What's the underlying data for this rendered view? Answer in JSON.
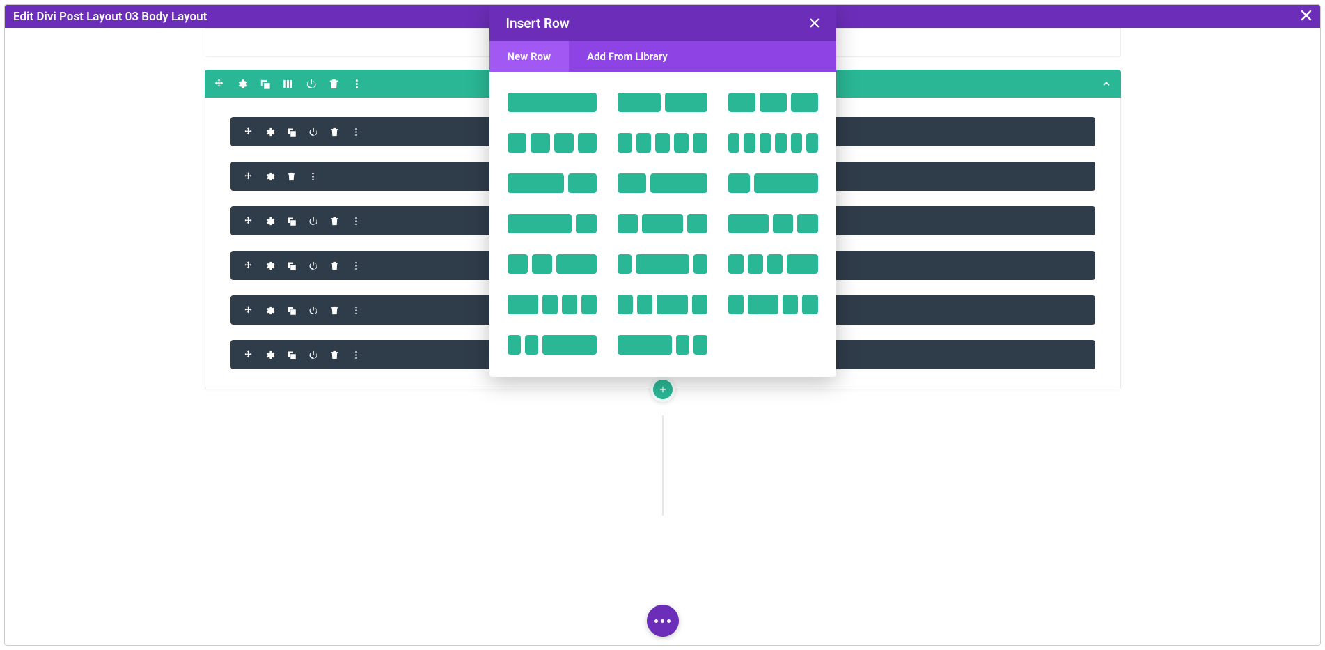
{
  "title_bar": {
    "title": "Edit Divi Post Layout 03 Body Layout"
  },
  "modal": {
    "title": "Insert Row",
    "tabs": [
      {
        "label": "New Row",
        "active": true
      },
      {
        "label": "Add From Library",
        "active": false
      }
    ],
    "layouts": [
      [
        1
      ],
      [
        1,
        1
      ],
      [
        1,
        1,
        1
      ],
      [
        1,
        1,
        1,
        1
      ],
      [
        1,
        1,
        1,
        1,
        1
      ],
      [
        1,
        1,
        1,
        1,
        1,
        1
      ],
      [
        2,
        1
      ],
      [
        1,
        2
      ],
      [
        1,
        3
      ],
      [
        3,
        1
      ],
      [
        1,
        2,
        1
      ],
      [
        2,
        1,
        1
      ],
      [
        1,
        1,
        2
      ],
      [
        1,
        4,
        1
      ],
      [
        1,
        1,
        1,
        2
      ],
      [
        2,
        1,
        1,
        1
      ],
      [
        1,
        1,
        2,
        1
      ],
      [
        1,
        2,
        1,
        1
      ],
      [
        1,
        1,
        4
      ],
      [
        4,
        1,
        1
      ]
    ]
  },
  "section": {
    "modules": [
      {
        "tools": [
          "move",
          "settings",
          "duplicate",
          "power",
          "trash",
          "more"
        ]
      },
      {
        "tools": [
          "move",
          "settings",
          "trash",
          "more"
        ]
      },
      {
        "tools": [
          "move",
          "settings",
          "duplicate",
          "power",
          "trash",
          "more"
        ]
      },
      {
        "tools": [
          "move",
          "settings",
          "duplicate",
          "power",
          "trash",
          "more"
        ]
      },
      {
        "tools": [
          "move",
          "settings",
          "duplicate",
          "power",
          "trash",
          "more"
        ]
      },
      {
        "tools": [
          "move",
          "settings",
          "duplicate",
          "power",
          "trash",
          "more"
        ]
      }
    ]
  },
  "colors": {
    "purple_primary": "#6c2eb9",
    "purple_light": "#8e44e4",
    "purple_active": "#a259f3",
    "teal": "#2ab795",
    "row_dark": "#2f3c4a"
  }
}
